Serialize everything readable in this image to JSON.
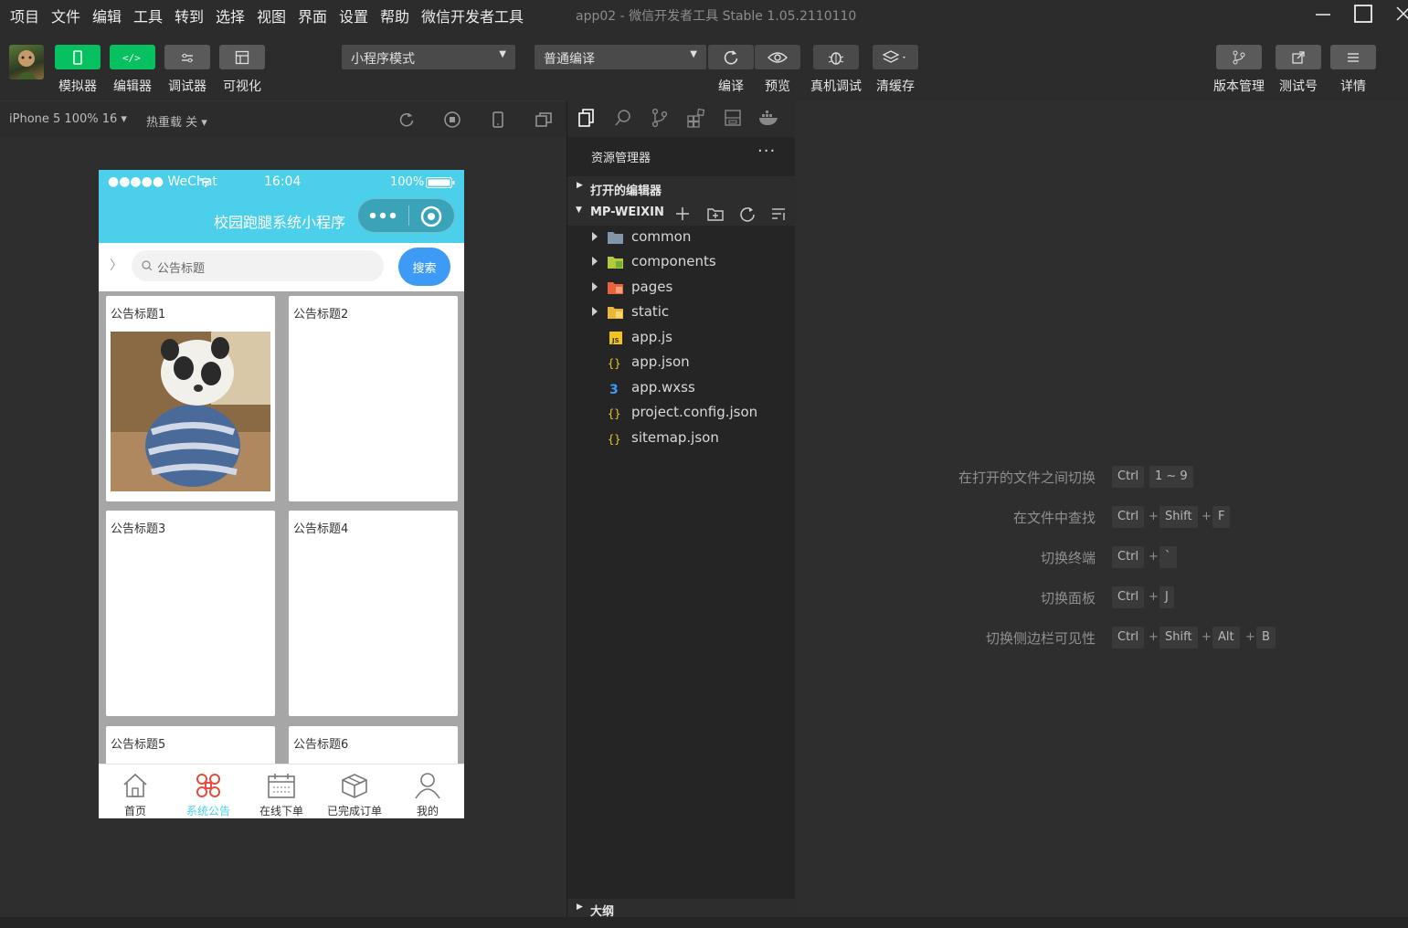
{
  "menubar": {
    "items": [
      "项目",
      "文件",
      "编辑",
      "工具",
      "转到",
      "选择",
      "视图",
      "界面",
      "设置",
      "帮助",
      "微信开发者工具"
    ],
    "window_title": "app02 - 微信开发者工具 Stable 1.05.2110110"
  },
  "toolbar": {
    "left_buttons": [
      "模拟器",
      "编辑器",
      "调试器",
      "可视化"
    ],
    "mode_dropdown": "小程序模式",
    "compile_dropdown": "普通编译",
    "action_buttons": [
      "编译",
      "预览",
      "真机调试",
      "清缓存"
    ],
    "right_buttons": [
      "版本管理",
      "测试号",
      "详情"
    ]
  },
  "simulator": {
    "device": "iPhone 5 100% 16",
    "hot_reload": "热重载 关",
    "status": {
      "carrier": "●●●●● WeChat",
      "time": "16:04",
      "battery": "100%"
    },
    "nav_title": "校园跑腿系统小程序",
    "search": {
      "placeholder": "公告标题",
      "button": "搜索"
    },
    "cards": [
      "公告标题1",
      "公告标题2",
      "公告标题3",
      "公告标题4",
      "公告标题5",
      "公告标题6"
    ],
    "tabs": [
      {
        "label": "首页",
        "icon": "home-icon"
      },
      {
        "label": "系统公告",
        "icon": "command-icon",
        "active": true
      },
      {
        "label": "在线下单",
        "icon": "calendar-icon"
      },
      {
        "label": "已完成订单",
        "icon": "box-icon"
      },
      {
        "label": "我的",
        "icon": "user-icon"
      }
    ],
    "active_tab_color": "#4ccfeb",
    "nav_color": "#4ccfeb"
  },
  "explorer": {
    "header": "资源管理器",
    "more": "···",
    "open_editors": "打开的编辑器",
    "project": "MP-WEIXIN",
    "tree": [
      {
        "name": "common",
        "type": "folder",
        "icon": "folder-icon"
      },
      {
        "name": "components",
        "type": "folder",
        "icon": "components-folder-icon"
      },
      {
        "name": "pages",
        "type": "folder",
        "icon": "pages-folder-icon"
      },
      {
        "name": "static",
        "type": "folder",
        "icon": "static-folder-icon"
      },
      {
        "name": "app.js",
        "type": "file",
        "icon": "js-file-icon"
      },
      {
        "name": "app.json",
        "type": "file",
        "icon": "json-file-icon"
      },
      {
        "name": "app.wxss",
        "type": "file",
        "icon": "css-file-icon"
      },
      {
        "name": "project.config.json",
        "type": "file",
        "icon": "json-file-icon"
      },
      {
        "name": "sitemap.json",
        "type": "file",
        "icon": "json-file-icon"
      }
    ],
    "outline": "大纲"
  },
  "shortcuts": [
    {
      "label": "在打开的文件之间切换",
      "keys": [
        "Ctrl",
        "1 ~ 9"
      ],
      "sep": [
        ""
      ]
    },
    {
      "label": "在文件中查找",
      "keys": [
        "Ctrl",
        "Shift",
        "F"
      ],
      "sep": [
        "+",
        "+"
      ]
    },
    {
      "label": "切换终端",
      "keys": [
        "Ctrl",
        "`"
      ],
      "sep": [
        "+"
      ]
    },
    {
      "label": "切换面板",
      "keys": [
        "Ctrl",
        "J"
      ],
      "sep": [
        "+"
      ]
    },
    {
      "label": "切换侧边栏可见性",
      "keys": [
        "Ctrl",
        "Shift",
        "Alt",
        "B"
      ],
      "sep": [
        "+",
        "+",
        "+"
      ]
    }
  ]
}
